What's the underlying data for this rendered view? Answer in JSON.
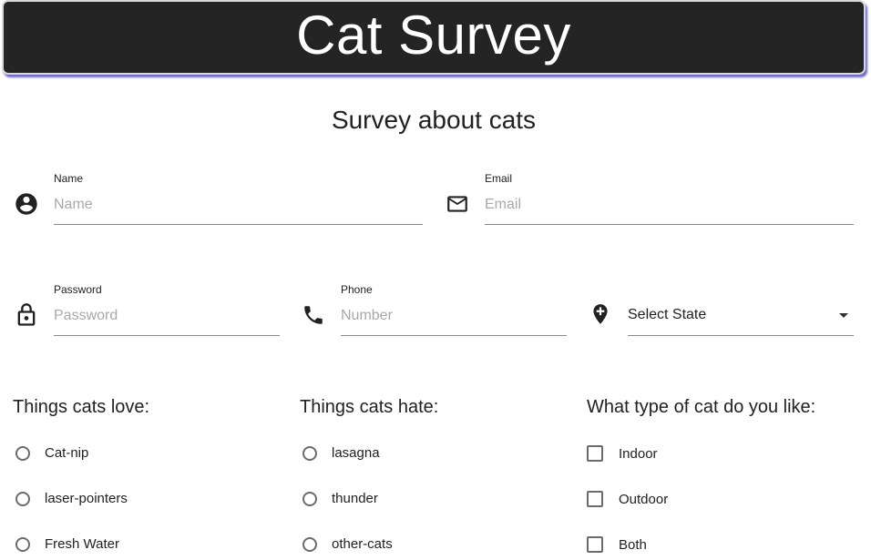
{
  "header": {
    "title": "Cat Survey"
  },
  "form": {
    "subtitle": "Survey about cats",
    "name": {
      "label": "Name",
      "placeholder": "Name",
      "icon": "account-circle-icon"
    },
    "email": {
      "label": "Email",
      "placeholder": "Email",
      "icon": "mail-icon"
    },
    "password": {
      "label": "Password",
      "placeholder": "Password",
      "icon": "lock-icon"
    },
    "phone": {
      "label": "Phone",
      "placeholder": "Number",
      "icon": "phone-icon"
    },
    "state": {
      "value": "Select State",
      "icon": "add-location-icon"
    }
  },
  "groups": {
    "love": {
      "title": "Things cats love:",
      "options": [
        "Cat-nip",
        "laser-pointers",
        "Fresh Water"
      ]
    },
    "hate": {
      "title": "Things cats hate:",
      "options": [
        "lasagna",
        "thunder",
        "other-cats"
      ]
    },
    "type": {
      "title": "What type of cat do you like:",
      "options": [
        "Indoor",
        "Outdoor",
        "Both"
      ]
    }
  },
  "colors": {
    "header_bg": "#242424",
    "header_shadow": "#6d68c8",
    "icon": "#212121"
  }
}
